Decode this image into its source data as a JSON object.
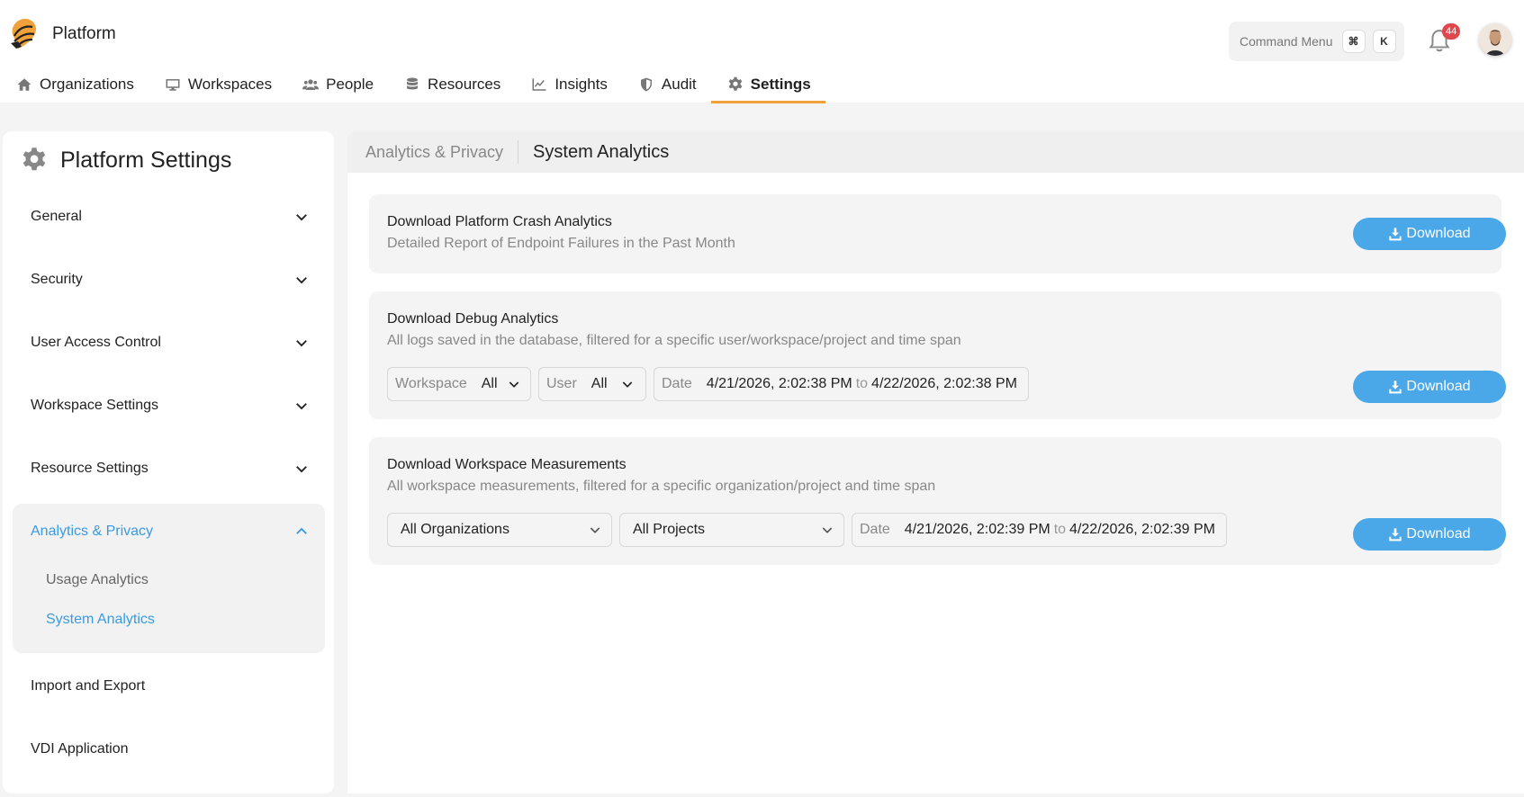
{
  "app": {
    "title": "Platform"
  },
  "header": {
    "command_menu": {
      "label": "Command Menu",
      "key1": "⌘",
      "key2": "K"
    },
    "notifications": {
      "count": "44"
    }
  },
  "nav": {
    "items": [
      {
        "label": "Organizations",
        "icon": "home-icon"
      },
      {
        "label": "Workspaces",
        "icon": "monitor-icon"
      },
      {
        "label": "People",
        "icon": "people-icon"
      },
      {
        "label": "Resources",
        "icon": "database-icon"
      },
      {
        "label": "Insights",
        "icon": "chart-line-icon"
      },
      {
        "label": "Audit",
        "icon": "shield-icon"
      },
      {
        "label": "Settings",
        "icon": "gear-icon",
        "active": true
      }
    ]
  },
  "sidebar": {
    "title": "Platform Settings",
    "items": [
      {
        "label": "General"
      },
      {
        "label": "Security"
      },
      {
        "label": "User Access Control"
      },
      {
        "label": "Workspace Settings"
      },
      {
        "label": "Resource Settings"
      },
      {
        "label": "Analytics & Privacy",
        "expanded": true
      },
      {
        "label": "Import and Export"
      },
      {
        "label": "VDI Application"
      }
    ],
    "subitems": [
      {
        "label": "Usage Analytics"
      },
      {
        "label": "System Analytics",
        "active": true
      }
    ]
  },
  "breadcrumb": {
    "parent": "Analytics & Privacy",
    "current": "System Analytics"
  },
  "cards": {
    "crash": {
      "title": "Download Platform Crash Analytics",
      "desc": "Detailed Report of Endpoint Failures in the Past Month",
      "button": "Download"
    },
    "debug": {
      "title": "Download Debug Analytics",
      "desc": "All logs saved in the database, filtered for a specific user/workspace/project and time span",
      "workspace_label": "Workspace",
      "workspace_value": "All",
      "user_label": "User",
      "user_value": "All",
      "date_label": "Date",
      "date_from": "4/21/2026, 2:02:38 PM",
      "to": "to",
      "date_to": "4/22/2026, 2:02:38 PM",
      "button": "Download"
    },
    "measurements": {
      "title": "Download Workspace Measurements",
      "desc": "All workspace measurements, filtered for a specific organization/project and time span",
      "org_value": "All Organizations",
      "project_value": "All Projects",
      "date_label": "Date",
      "date_from": "4/21/2026, 2:02:39 PM",
      "to": "to",
      "date_to": "4/22/2026, 2:02:39 PM",
      "button": "Download"
    }
  },
  "colors": {
    "accent": "#f0a13a",
    "link": "#3b9be0",
    "button": "#4aa8e8",
    "badge": "#e0474c"
  }
}
